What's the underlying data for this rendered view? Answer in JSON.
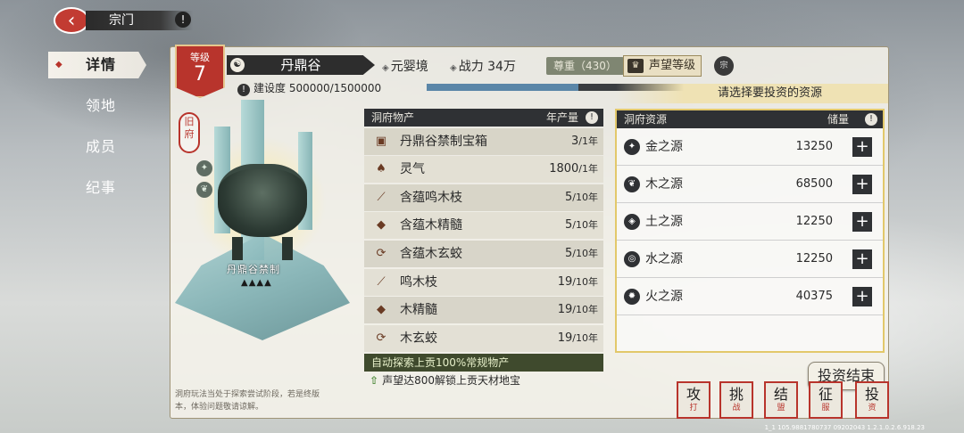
{
  "header": {
    "title": "宗门",
    "back_icon": "back-arrow-icon",
    "help_glyph": "!"
  },
  "nav": {
    "items": [
      {
        "label": "详情",
        "active": true
      },
      {
        "label": "领地",
        "active": false
      },
      {
        "label": "成员",
        "active": false
      },
      {
        "label": "纪事",
        "active": false
      }
    ]
  },
  "sect": {
    "level_label": "等级",
    "level": "7",
    "name": "丹鼎谷",
    "realm": "元婴境",
    "power": "战力 34万",
    "prestige_badge": "尊重（430）",
    "prestige_button": "声望等级",
    "construction_label": "建设度",
    "construction_value": "500000/1500000",
    "construction_progress": 0.333
  },
  "hint": "请选择要投资的资源",
  "artwork": {
    "seal_text": "旧府",
    "name": "丹鼎谷禁制",
    "drops": "▲▲▲▲"
  },
  "description": "洞府玩法当处于探索尝试阶段，若是终版本，体验问题敬请谅解。",
  "products": {
    "header_left": "洞府物产",
    "header_right": "年产量",
    "help_glyph": "!",
    "items": [
      {
        "icon": "treasure-chest-icon",
        "glyph": "▣",
        "name": "丹鼎谷禁制宝箱",
        "amount": "3",
        "unit": "/1年"
      },
      {
        "icon": "spirit-gourd-icon",
        "glyph": "♠",
        "name": "灵气",
        "amount": "1800",
        "unit": "/1年"
      },
      {
        "icon": "branch-icon",
        "glyph": "⟋",
        "name": "含蕴鸣木枝",
        "amount": "5",
        "unit": "/10年"
      },
      {
        "icon": "marrow-icon",
        "glyph": "◆",
        "name": "含蕴木精髓",
        "amount": "5",
        "unit": "/10年"
      },
      {
        "icon": "serpent-icon",
        "glyph": "⟳",
        "name": "含蕴木玄蛟",
        "amount": "5",
        "unit": "/10年"
      },
      {
        "icon": "branch-icon",
        "glyph": "⟋",
        "name": "鸣木枝",
        "amount": "19",
        "unit": "/10年"
      },
      {
        "icon": "marrow-icon",
        "glyph": "◆",
        "name": "木精髓",
        "amount": "19",
        "unit": "/10年"
      },
      {
        "icon": "serpent-icon",
        "glyph": "⟳",
        "name": "木玄蛟",
        "amount": "19",
        "unit": "/10年"
      }
    ],
    "auto_explore": "自动探索上贡100%常规物产",
    "unlock_hint": "声望达800解锁上贡天材地宝"
  },
  "resources": {
    "header_left": "洞府资源",
    "header_right": "储量",
    "help_glyph": "!",
    "items": [
      {
        "icon": "metal-source-icon",
        "glyph": "✦",
        "name": "金之源",
        "amount": "13250"
      },
      {
        "icon": "wood-source-icon",
        "glyph": "❦",
        "name": "木之源",
        "amount": "68500"
      },
      {
        "icon": "earth-source-icon",
        "glyph": "◈",
        "name": "土之源",
        "amount": "12250"
      },
      {
        "icon": "water-source-icon",
        "glyph": "◎",
        "name": "水之源",
        "amount": "12250"
      },
      {
        "icon": "fire-source-icon",
        "glyph": "✹",
        "name": "火之源",
        "amount": "40375"
      }
    ],
    "add_glyph": "+"
  },
  "finish_button": "投资结束",
  "actions": [
    {
      "main": "攻",
      "sub": "打"
    },
    {
      "main": "挑",
      "sub": "战"
    },
    {
      "main": "结",
      "sub": "盟"
    },
    {
      "main": "征",
      "sub": "服"
    },
    {
      "main": "投",
      "sub": "资"
    }
  ],
  "version": "1_1 105.9881780737 09202043 1.2.1.0.2.6.918.23",
  "colors": {
    "accent_red": "#b8342c",
    "dark_header": "#2f3134",
    "highlight_gold": "#e2c86a",
    "progress_blue": "#5a86a8"
  }
}
